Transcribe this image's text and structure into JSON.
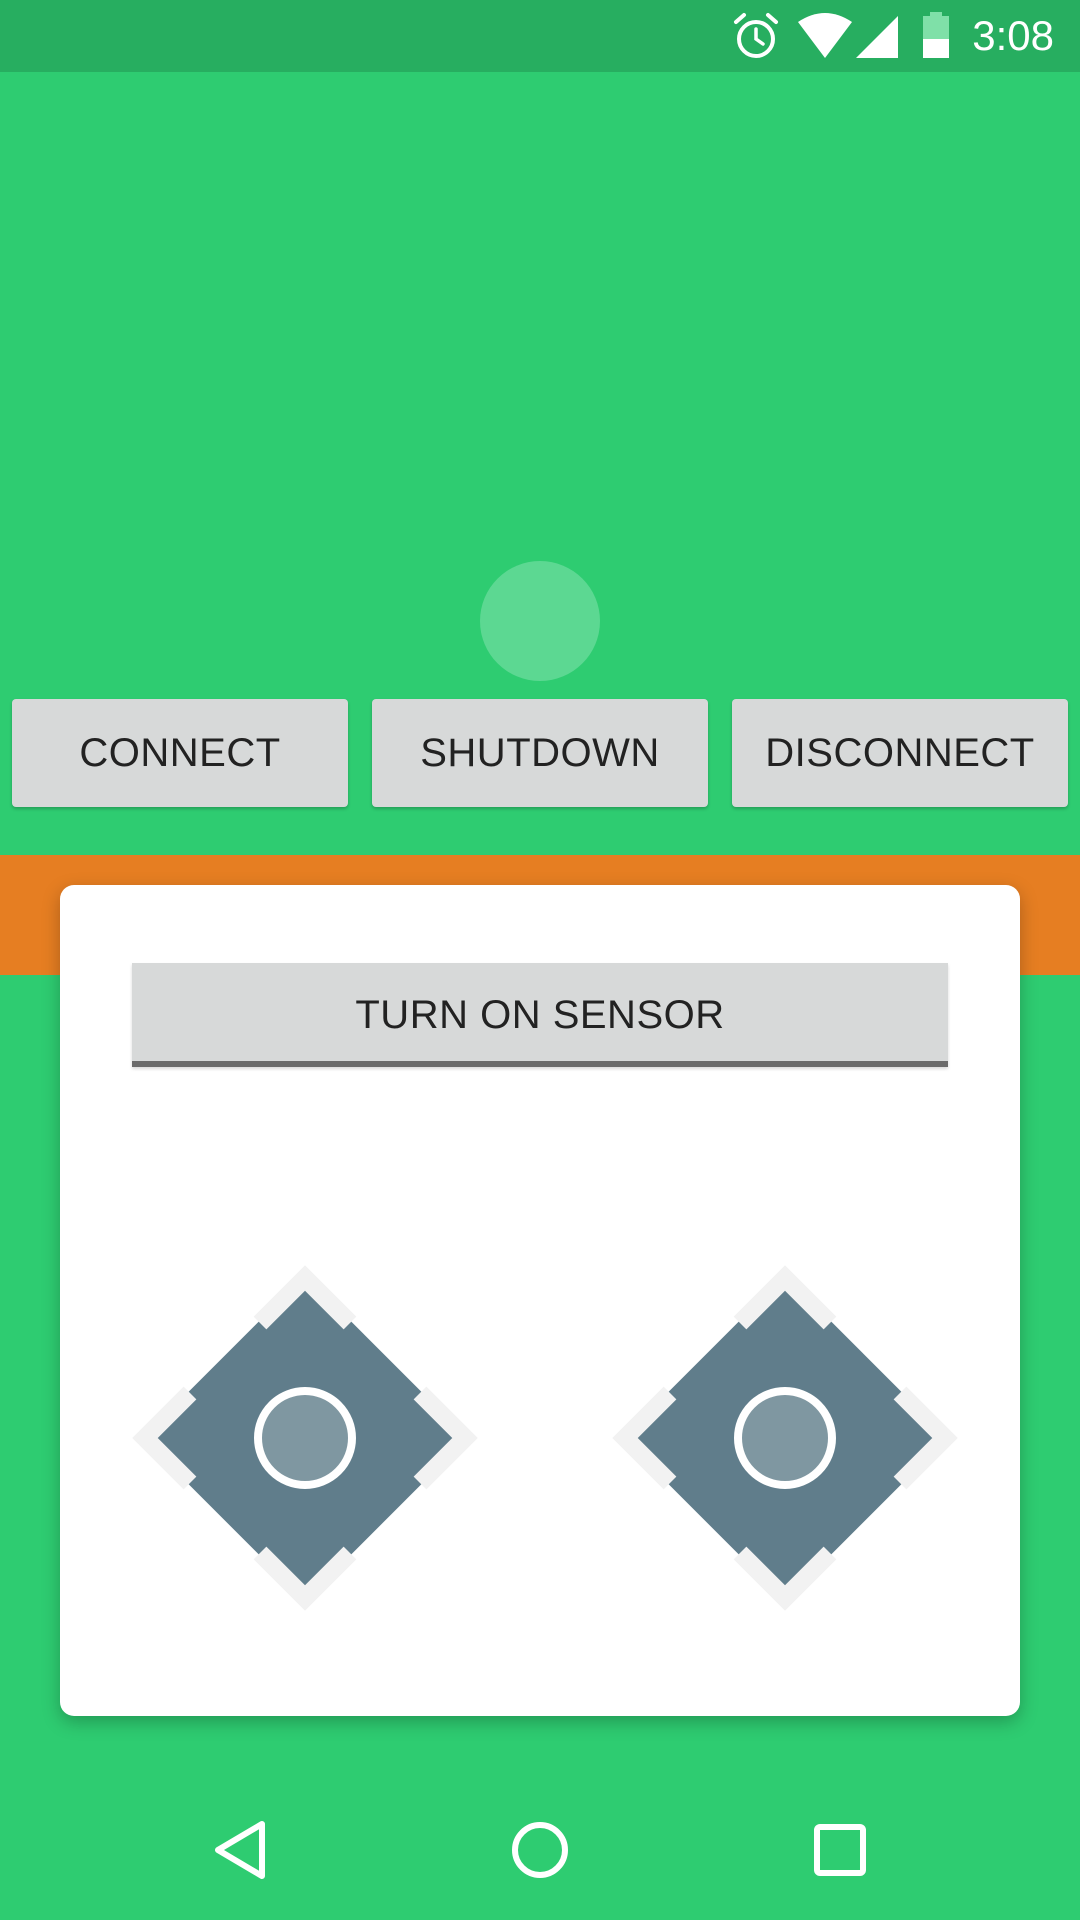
{
  "status_bar": {
    "time": "3:08",
    "icons": [
      "alarm-icon",
      "wifi-icon",
      "cellular-signal-icon",
      "battery-icon"
    ]
  },
  "controls": {
    "connect_label": "CONNECT",
    "shutdown_label": "SHUTDOWN",
    "disconnect_label": "DISCONNECT"
  },
  "card": {
    "sensor_button_label": "TURN ON SENSOR",
    "dpads": [
      "left-dpad",
      "right-dpad"
    ]
  },
  "nav_bar": {
    "icons": [
      "back-icon",
      "home-icon",
      "recents-icon"
    ]
  },
  "colors": {
    "background": "#2ecc71",
    "status_bar": "#27ae60",
    "accent_band": "#e67e22",
    "button": "#d7d9d9",
    "dpad": "#607d8b"
  }
}
